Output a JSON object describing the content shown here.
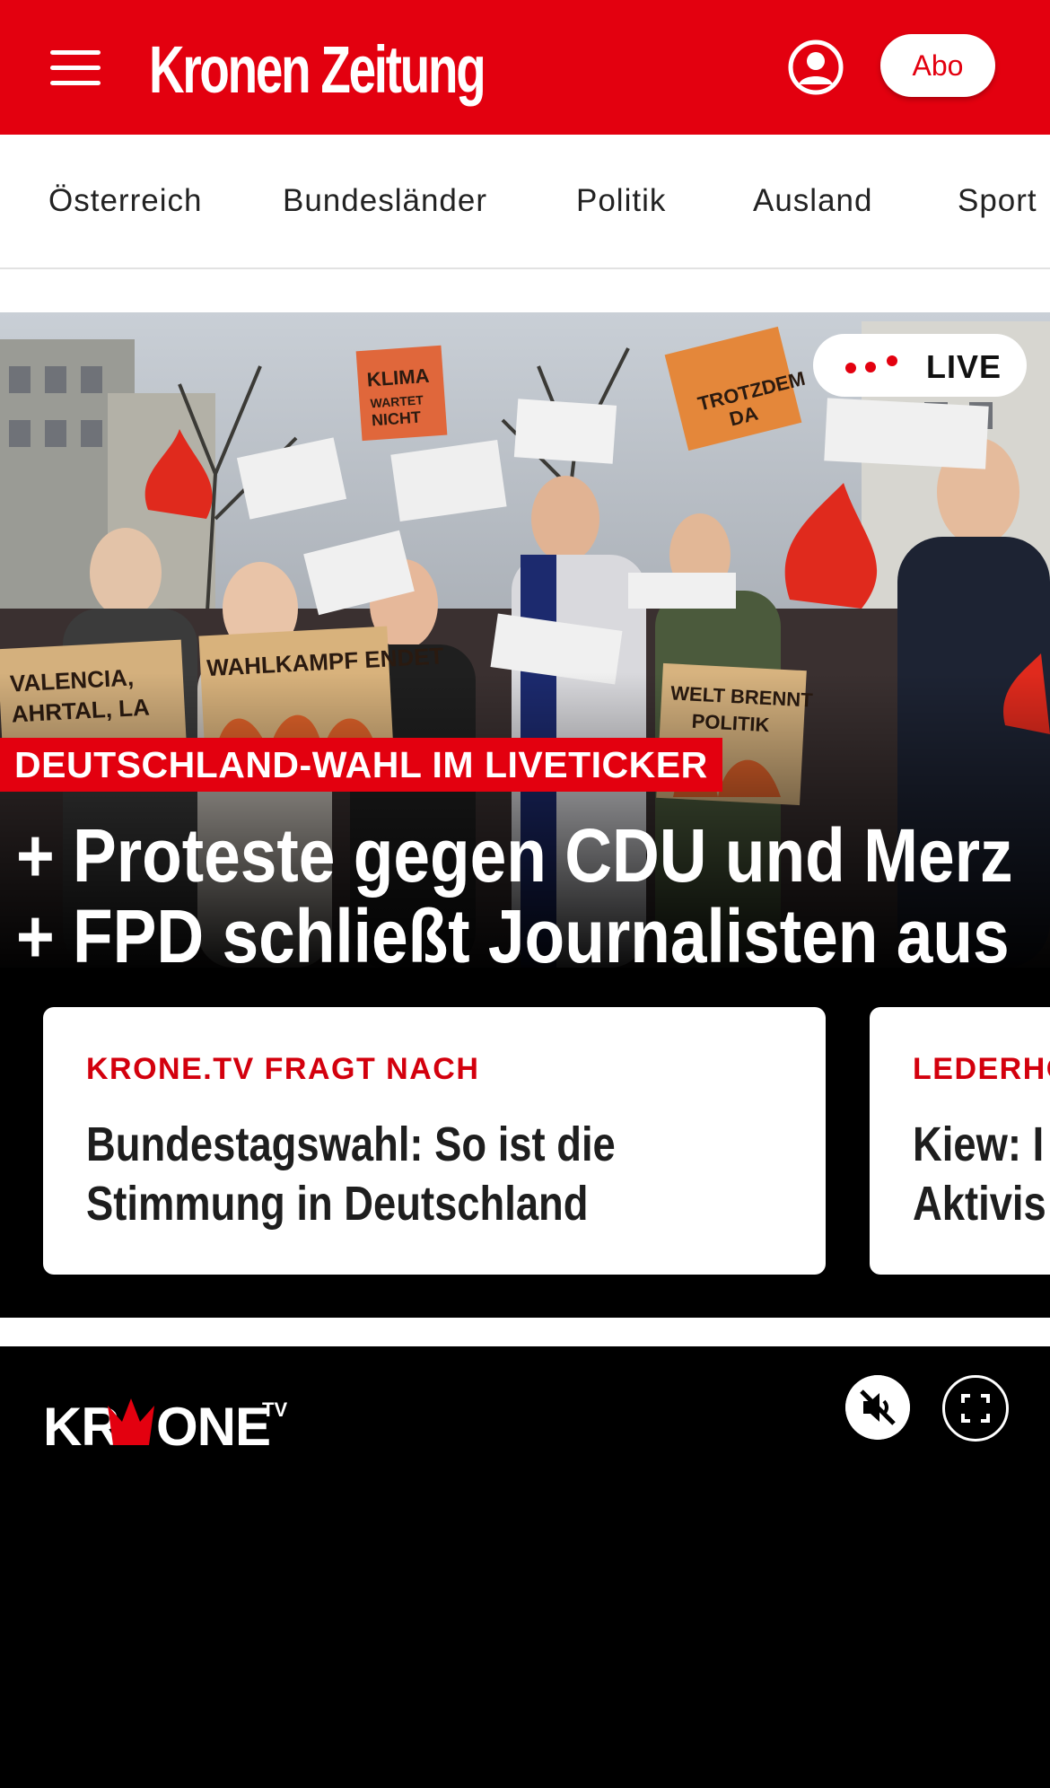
{
  "header": {
    "logo": "Kronen Zeitung",
    "menu_icon": "hamburger-menu-icon",
    "user_icon": "user-account-icon",
    "abo_label": "Abo"
  },
  "nav": {
    "items": [
      {
        "label": "Österreich"
      },
      {
        "label": "Bundesländer"
      },
      {
        "label": "Politik"
      },
      {
        "label": "Ausland"
      },
      {
        "label": "Sport"
      }
    ]
  },
  "hero": {
    "live_label": "LIVE",
    "kicker": "DEUTSCHLAND-WAHL IM LIVETICKER",
    "headline_lines": [
      "+ Proteste gegen CDU und Merz",
      "+ FPD schließt Journalisten aus"
    ],
    "photo_signs": [
      "KLIMA WARTET NICHT",
      "VALENCIA, AHRTAL, LA",
      "WAHLKAMPF ENDET",
      "WELT BRENNT POLITIK",
      "TROTZDEM DA"
    ]
  },
  "cards": [
    {
      "kicker": "KRONE.TV FRAGT NACH",
      "title_lines": [
        "Bundestagswahl: So ist die",
        "Stimmung in Deutschland"
      ]
    },
    {
      "kicker": "LEDERHO",
      "title_lines": [
        "Kiew: I",
        "Aktivis"
      ]
    }
  ],
  "video": {
    "logo_text": "KRONE",
    "logo_sup": "TV",
    "mute_icon": "muted-speaker-icon",
    "fullscreen_icon": "fullscreen-icon"
  },
  "colors": {
    "brand_red": "#e3000f",
    "black": "#000000",
    "white": "#ffffff"
  }
}
